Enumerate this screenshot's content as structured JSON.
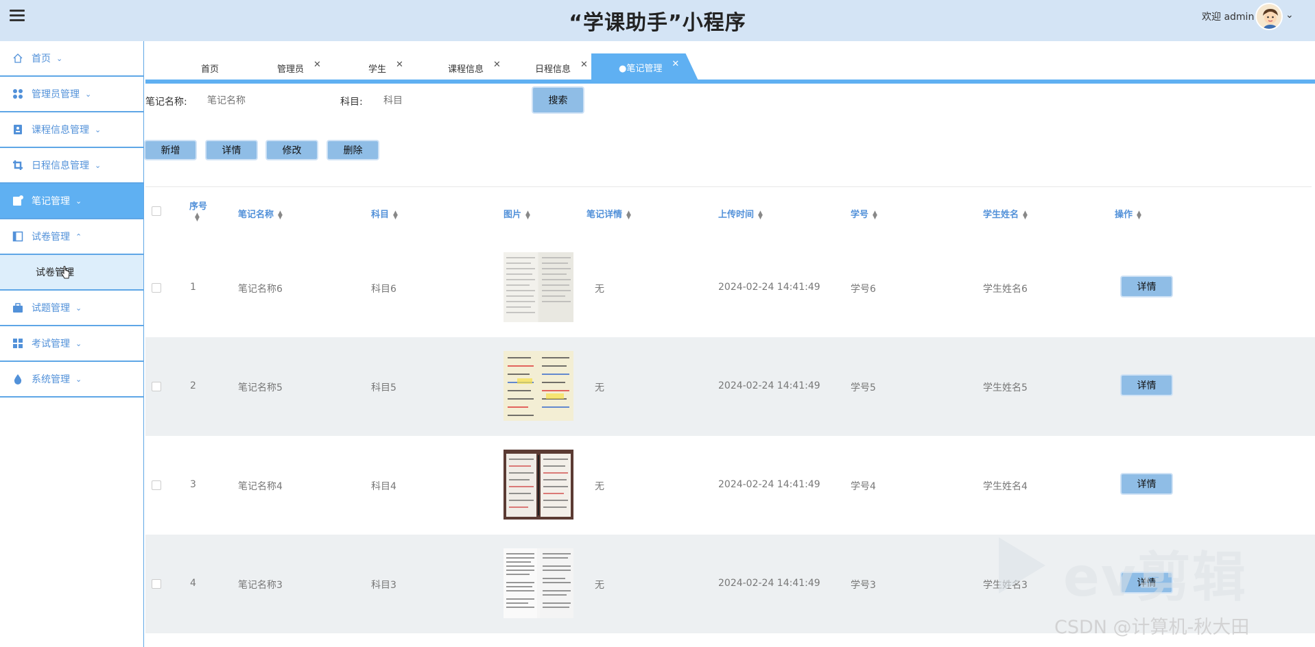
{
  "header": {
    "app_title": "“学课助手”小程序",
    "welcome": "欢迎 admin"
  },
  "sidebar": {
    "items": [
      {
        "label": "首页",
        "icon": "home-icon"
      },
      {
        "label": "管理员管理",
        "icon": "apps-icon"
      },
      {
        "label": "课程信息管理",
        "icon": "contact-card-icon"
      },
      {
        "label": "日程信息管理",
        "icon": "crop-icon"
      },
      {
        "label": "笔记管理",
        "icon": "note-icon",
        "active": true
      },
      {
        "label": "试卷管理",
        "icon": "layout-icon",
        "expanded": true
      },
      {
        "label": "试题管理",
        "icon": "toolbox-icon"
      },
      {
        "label": "考试管理",
        "icon": "grid-icon"
      },
      {
        "label": "系统管理",
        "icon": "drop-icon"
      }
    ],
    "submenu": {
      "label": "试卷管理"
    }
  },
  "tabs": [
    {
      "label": "首页",
      "closable": false
    },
    {
      "label": "管理员",
      "closable": true
    },
    {
      "label": "学生",
      "closable": true
    },
    {
      "label": "课程信息",
      "closable": true
    },
    {
      "label": "日程信息",
      "closable": true
    },
    {
      "label": "●笔记管理",
      "closable": true,
      "active": true
    }
  ],
  "search": {
    "name_label": "笔记名称:",
    "name_placeholder": "笔记名称",
    "subject_label": "科目:",
    "subject_placeholder": "科目",
    "button": "搜索"
  },
  "actions": {
    "add": "新增",
    "detail": "详情",
    "edit": "修改",
    "delete": "删除"
  },
  "table": {
    "columns": [
      "序号",
      "笔记名称",
      "科目",
      "图片",
      "笔记详情",
      "上传时间",
      "学号",
      "学生姓名",
      "操作"
    ],
    "rows": [
      {
        "index": "1",
        "name": "笔记名称6",
        "subject": "科目6",
        "detail": "无",
        "time": "2024-02-24 14:41:49",
        "student_no": "学号6",
        "student_name": "学生姓名6",
        "action": "详情"
      },
      {
        "index": "2",
        "name": "笔记名称5",
        "subject": "科目5",
        "detail": "无",
        "time": "2024-02-24 14:41:49",
        "student_no": "学号5",
        "student_name": "学生姓名5",
        "action": "详情"
      },
      {
        "index": "3",
        "name": "笔记名称4",
        "subject": "科目4",
        "detail": "无",
        "time": "2024-02-24 14:41:49",
        "student_no": "学号4",
        "student_name": "学生姓名4",
        "action": "详情"
      },
      {
        "index": "4",
        "name": "笔记名称3",
        "subject": "科目3",
        "detail": "无",
        "time": "2024-02-24 14:41:49",
        "student_no": "学号3",
        "student_name": "学生姓名3",
        "action": "详情"
      }
    ]
  },
  "watermarks": {
    "ev": "ev剪辑",
    "csdn": "CSDN @计算机-秋大田"
  },
  "colors": {
    "header_bg": "#d4e4f5",
    "accent": "#5fb0f2",
    "link_blue": "#5291d9",
    "button_bg": "#8fbde6",
    "row_alt": "#edf0f2"
  }
}
